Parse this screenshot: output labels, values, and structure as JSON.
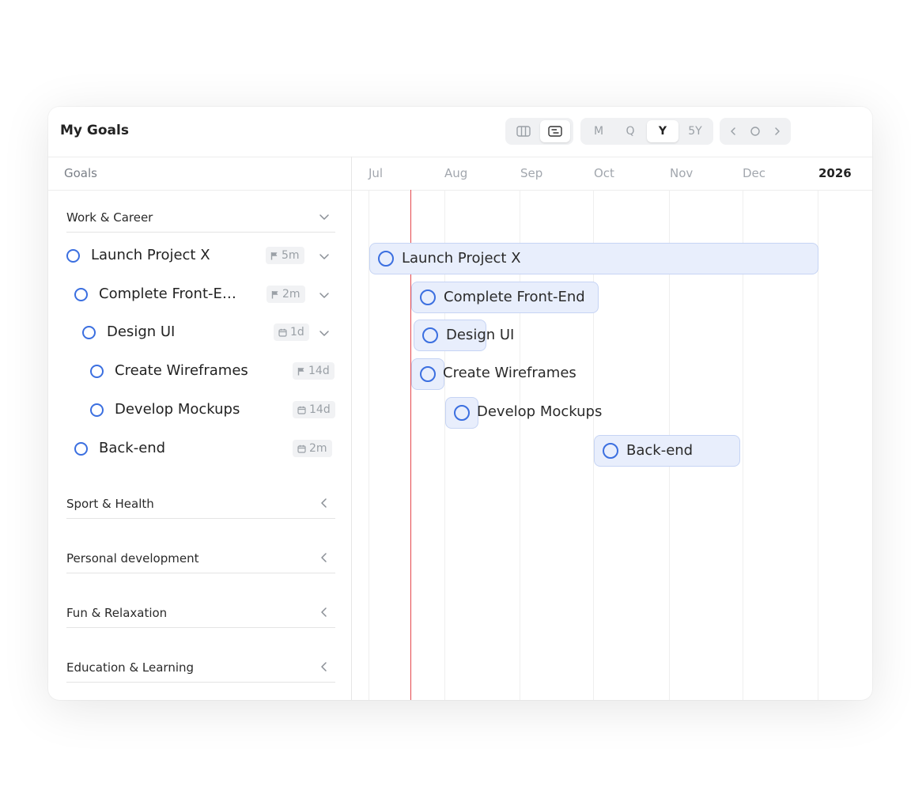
{
  "app_title": "My Goals",
  "view_toggle": {
    "options": [
      "columns-icon",
      "timeline-list-icon"
    ],
    "active": "timeline-list-icon"
  },
  "zoom": {
    "options": [
      "M",
      "Q",
      "Y",
      "5Y"
    ],
    "active": "Y"
  },
  "nav": {
    "prev_icon": "chevron-left-icon",
    "today_icon": "circle-icon",
    "next_icon": "chevron-right-icon"
  },
  "columns_header": "Goals",
  "months": [
    "Jul",
    "Aug",
    "Sep",
    "Oct",
    "Nov",
    "Dec"
  ],
  "year_label": "2026",
  "categories": [
    {
      "label": "Work & Career",
      "expanded": true
    },
    {
      "label": "Sport & Health",
      "expanded": false
    },
    {
      "label": "Personal development",
      "expanded": false
    },
    {
      "label": "Fun & Relaxation",
      "expanded": false
    },
    {
      "label": "Education & Learning",
      "expanded": false
    }
  ],
  "goals": [
    {
      "label": "Launch Project X",
      "badge_icon": "flag-icon",
      "badge": "5m",
      "expandable": true,
      "bar_label": "Launch Project X"
    },
    {
      "label": "Complete Front-E…",
      "badge_icon": "flag-icon",
      "badge": "2m",
      "expandable": true,
      "bar_label": "Complete Front-End"
    },
    {
      "label": "Design UI",
      "badge_icon": "calendar-icon",
      "badge": "1d",
      "expandable": true,
      "bar_label": "Design UI"
    },
    {
      "label": "Create Wireframes",
      "badge_icon": "flag-icon",
      "badge": "14d",
      "expandable": false,
      "bar_label": "Create Wireframes"
    },
    {
      "label": "Develop Mockups",
      "badge_icon": "calendar-icon",
      "badge": "14d",
      "expandable": false,
      "bar_label": "Develop Mockups"
    },
    {
      "label": "Back-end",
      "badge_icon": "calendar-icon",
      "badge": "2m",
      "expandable": false,
      "bar_label": "Back-end"
    }
  ],
  "colors": {
    "accent": "#3b6fe0",
    "bar_fill": "#e8eefc",
    "today_line": "#e5484d"
  }
}
